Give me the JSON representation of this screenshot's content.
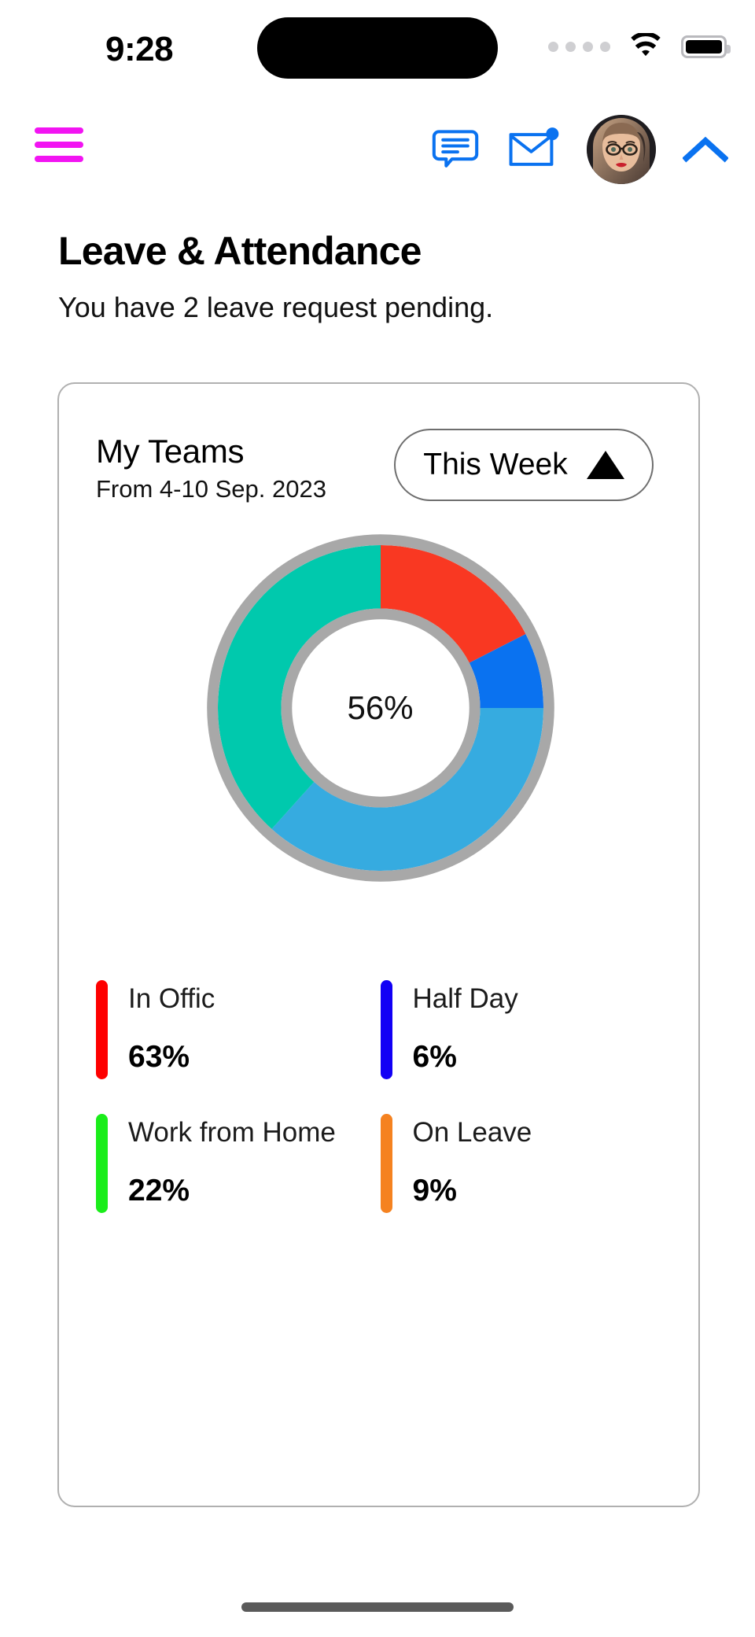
{
  "status_bar": {
    "time": "9:28",
    "signal_icon": "signal-dots-icon",
    "wifi_icon": "wifi-icon",
    "battery_icon": "battery-full-icon"
  },
  "nav_bar": {
    "menu_icon": "hamburger-menu-icon",
    "menu_color": "#f214f2",
    "chat_icon": "chat-bubble-icon",
    "mail_icon": "mail-envelope-icon",
    "mail_badge": "notification-dot",
    "avatar_icon": "user-avatar",
    "collapse_icon": "chevron-up-icon",
    "accent_color": "#0a72f0"
  },
  "header": {
    "title": "Leave & Attendance",
    "subtitle": "You have 2 leave request pending."
  },
  "card": {
    "title": "My Teams",
    "date_range": "From 4-10 Sep. 2023",
    "filter": {
      "label": "This Week",
      "icon": "triangle-up-icon"
    },
    "center_value": "56%"
  },
  "chart_data": {
    "type": "pie",
    "title": "My Teams",
    "subtitle": "From 4-10 Sep. 2023",
    "center_label": "56%",
    "donut": true,
    "ring_border_color": "#a8a8a8",
    "segments": [
      {
        "name": "red-segment",
        "color": "#f93822",
        "start_angle": 0,
        "end_angle": 63,
        "percent": 17.5
      },
      {
        "name": "blue-segment",
        "color": "#0a72f0",
        "start_angle": 63,
        "end_angle": 90,
        "percent": 7.5
      },
      {
        "name": "light-blue-segment",
        "color": "#36abe0",
        "start_angle": 90,
        "end_angle": 222,
        "percent": 36.7
      },
      {
        "name": "teal-segment",
        "color": "#00c9ad",
        "start_angle": 222,
        "end_angle": 360,
        "percent": 38.3
      }
    ],
    "legend": [
      {
        "label": "In Offic",
        "value": "63%",
        "color": "#fe0000"
      },
      {
        "label": "Half Day",
        "value": "6%",
        "color": "#1200f5"
      },
      {
        "label": "Work from Home",
        "value": "22%",
        "color": "#1aed1a"
      },
      {
        "label": "On Leave",
        "value": "9%",
        "color": "#f58220"
      }
    ],
    "categories": [
      "In Offic",
      "Half Day",
      "Work from Home",
      "On Leave"
    ],
    "values": [
      63,
      6,
      22,
      9
    ],
    "legend_position": "bottom"
  },
  "home_indicator": "home-indicator-bar"
}
